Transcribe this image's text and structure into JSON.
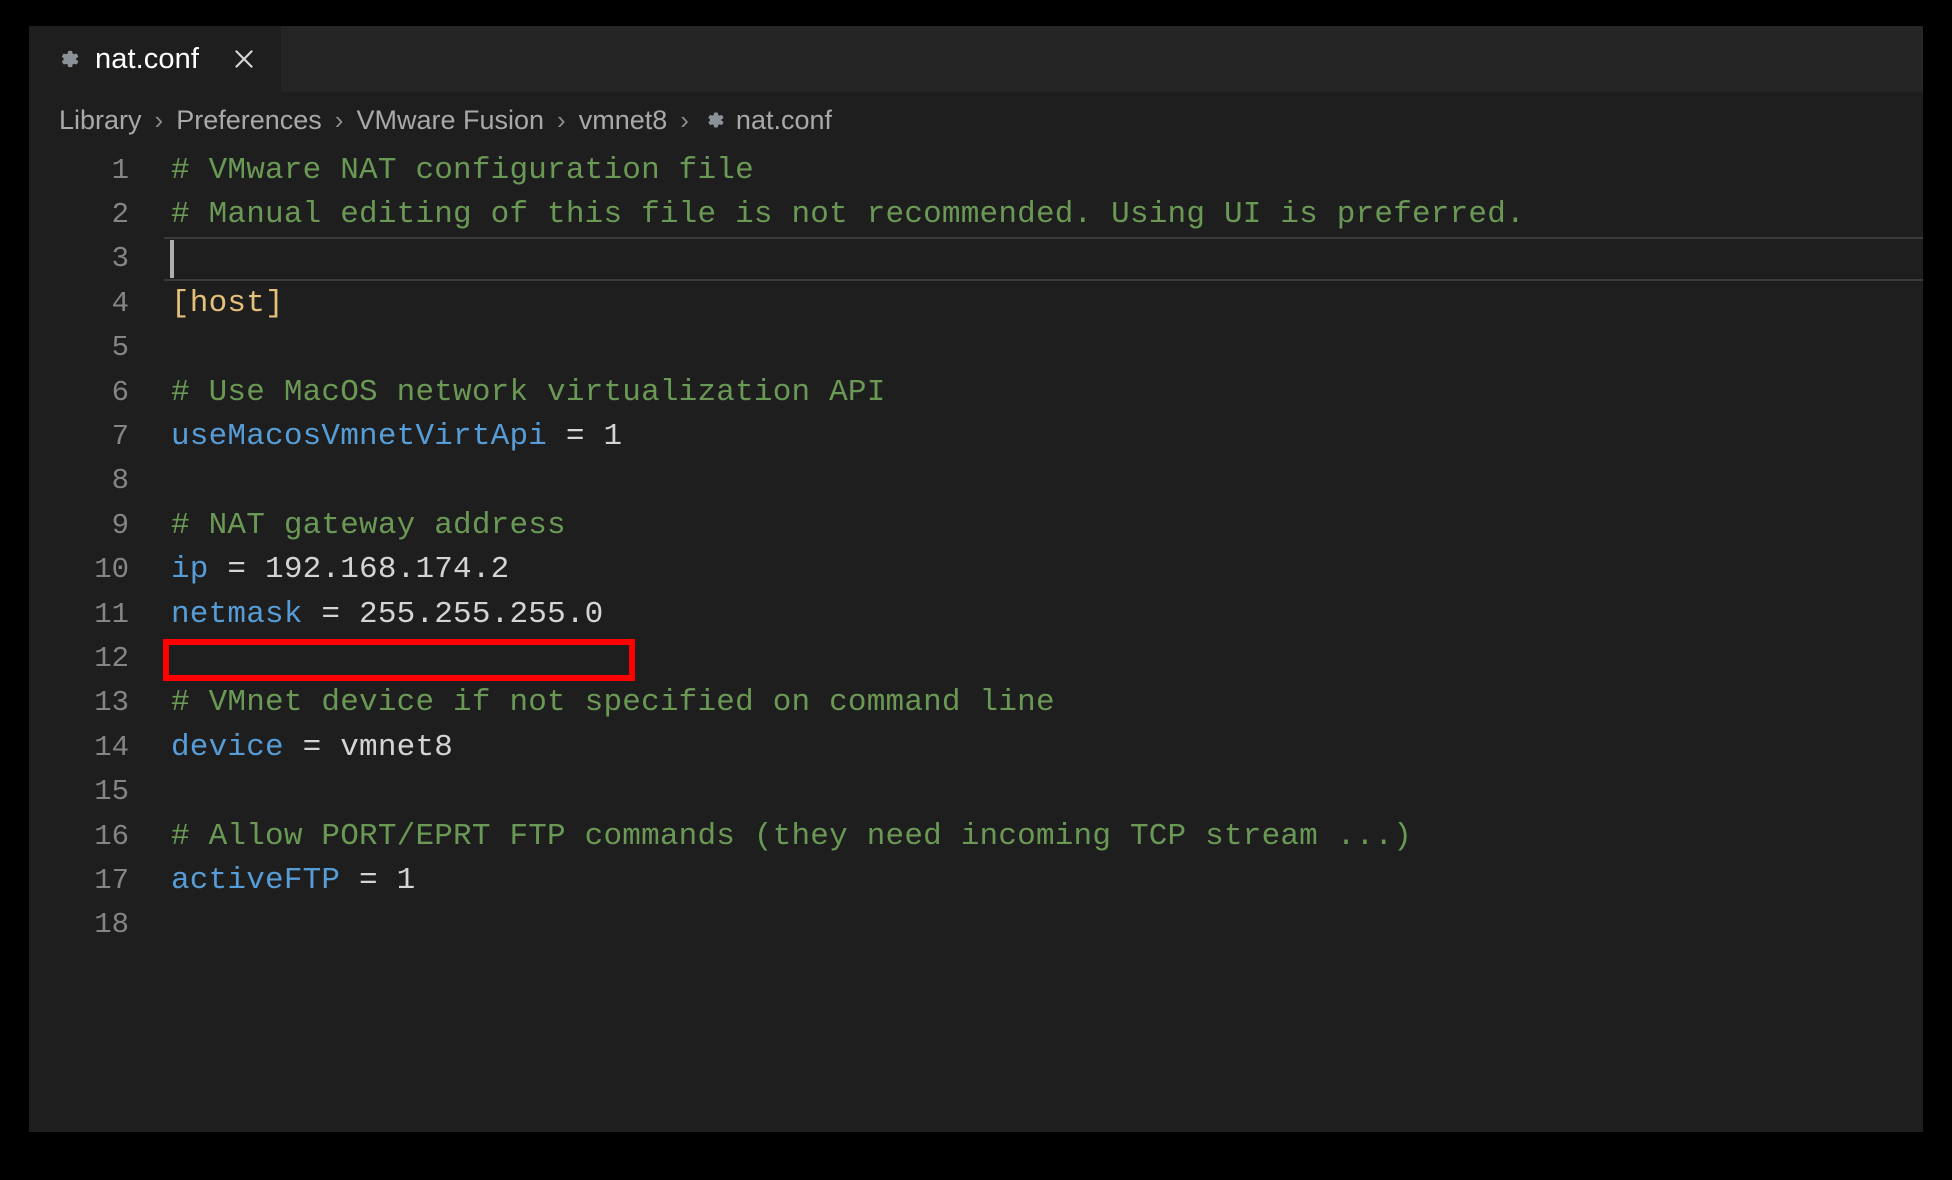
{
  "window": {
    "background": "#1e1e1e",
    "frame_color": "#000000"
  },
  "tab": {
    "icon": "gear-icon",
    "title": "nat.conf",
    "close_label": "×",
    "active": true
  },
  "breadcrumb": {
    "separator": "›",
    "items": [
      {
        "label": "Library",
        "icon": null
      },
      {
        "label": "Preferences",
        "icon": null
      },
      {
        "label": "VMware Fusion",
        "icon": null
      },
      {
        "label": "vmnet8",
        "icon": null
      },
      {
        "label": "nat.conf",
        "icon": "gear-icon"
      }
    ]
  },
  "editor": {
    "language": "ini",
    "cursor_line": 3,
    "cursor_column": 1,
    "colors": {
      "comment": "#6a9955",
      "key": "#569cd6",
      "value": "#d4d4d4",
      "section": "#e5c07b",
      "line_number": "#858585",
      "background": "#1e1e1e"
    },
    "lines": [
      {
        "n": "1",
        "tokens": [
          {
            "t": "# VMware NAT configuration file",
            "c": "c-comment"
          }
        ]
      },
      {
        "n": "2",
        "tokens": [
          {
            "t": "# Manual editing of this file is not recommended. Using UI is preferred.",
            "c": "c-comment"
          }
        ]
      },
      {
        "n": "3",
        "tokens": [],
        "current": true
      },
      {
        "n": "4",
        "tokens": [
          {
            "t": "[host]",
            "c": "c-section"
          }
        ]
      },
      {
        "n": "5",
        "tokens": []
      },
      {
        "n": "6",
        "tokens": [
          {
            "t": "# Use MacOS network virtualization API",
            "c": "c-comment"
          }
        ]
      },
      {
        "n": "7",
        "tokens": [
          {
            "t": "useMacosVmnetVirtApi",
            "c": "c-key"
          },
          {
            "t": " = ",
            "c": "c-op"
          },
          {
            "t": "1",
            "c": "c-val"
          }
        ]
      },
      {
        "n": "8",
        "tokens": []
      },
      {
        "n": "9",
        "tokens": [
          {
            "t": "# NAT gateway address",
            "c": "c-comment"
          }
        ]
      },
      {
        "n": "10",
        "tokens": [
          {
            "t": "ip",
            "c": "c-key"
          },
          {
            "t": " = ",
            "c": "c-op"
          },
          {
            "t": "192.168.174.2",
            "c": "c-val"
          }
        ],
        "highlighted": true
      },
      {
        "n": "11",
        "tokens": [
          {
            "t": "netmask",
            "c": "c-key"
          },
          {
            "t": " = ",
            "c": "c-op"
          },
          {
            "t": "255.255.255.0",
            "c": "c-val"
          }
        ]
      },
      {
        "n": "12",
        "tokens": []
      },
      {
        "n": "13",
        "tokens": [
          {
            "t": "# VMnet device if not specified on command line",
            "c": "c-comment"
          }
        ]
      },
      {
        "n": "14",
        "tokens": [
          {
            "t": "device",
            "c": "c-key"
          },
          {
            "t": " = ",
            "c": "c-op"
          },
          {
            "t": "vmnet8",
            "c": "c-val"
          }
        ]
      },
      {
        "n": "15",
        "tokens": []
      },
      {
        "n": "16",
        "tokens": [
          {
            "t": "# Allow PORT/EPRT FTP commands (they need incoming TCP stream ...)",
            "c": "c-comment"
          }
        ]
      },
      {
        "n": "17",
        "tokens": [
          {
            "t": "activeFTP",
            "c": "c-key"
          },
          {
            "t": " = ",
            "c": "c-op"
          },
          {
            "t": "1",
            "c": "c-val"
          }
        ]
      },
      {
        "n": "18",
        "tokens": []
      }
    ]
  },
  "annotation": {
    "type": "highlight-rectangle",
    "color": "#ff0000",
    "target_line": "10",
    "target_text": "ip = 192.168.174.2"
  }
}
